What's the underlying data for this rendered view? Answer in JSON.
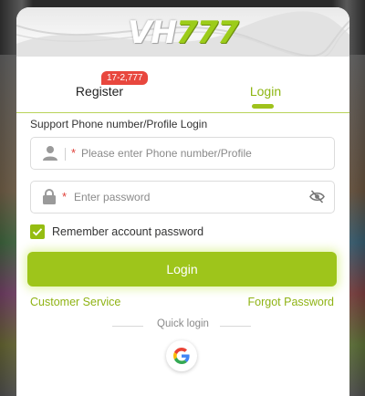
{
  "app": {
    "logo_prefix": "VH",
    "logo_suffix": "777"
  },
  "tabs": [
    {
      "label": "Register",
      "badge": "17-2,777",
      "active": false
    },
    {
      "label": "Login",
      "active": true
    }
  ],
  "form": {
    "phone_label": "Support Phone number/Profile Login",
    "phone_placeholder": "Please enter Phone number/Profile",
    "password_placeholder": "Enter password",
    "required_mark": "*",
    "remember_label": "Remember account password",
    "remember_checked": true,
    "login_button": "Login"
  },
  "links": {
    "customer_service": "Customer Service",
    "forgot_password": "Forgot Password"
  },
  "quick_login": {
    "label": "Quick login",
    "providers": [
      "google-icon"
    ]
  },
  "icons": {
    "phone_field": "user-icon",
    "password_field": "lock-icon",
    "password_toggle": "eye-off-icon",
    "remember": "checkmark-icon"
  },
  "colors": {
    "accent": "#9ec51b",
    "badge": "#e8473e",
    "required": "#e0403a"
  }
}
